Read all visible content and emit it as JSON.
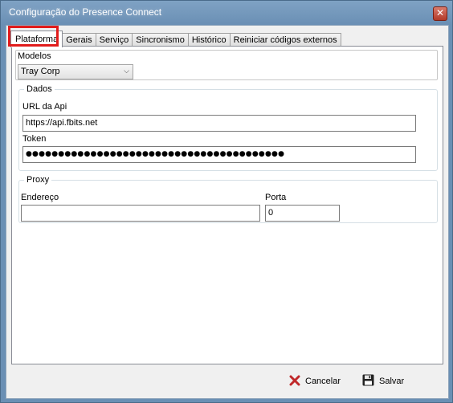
{
  "window": {
    "title": "Configuração do Presence Connect",
    "close_glyph": "✕"
  },
  "tabs": [
    {
      "label": "Plataforma",
      "active": true,
      "highlighted": true
    },
    {
      "label": "Gerais"
    },
    {
      "label": "Serviço"
    },
    {
      "label": "Sincronismo"
    },
    {
      "label": "Histórico"
    },
    {
      "label": "Reiniciar códigos externos"
    }
  ],
  "modelos": {
    "label": "Modelos",
    "selected": "Tray Corp",
    "icon": "chevron-down-icon"
  },
  "dados": {
    "legend": "Dados",
    "url_label": "URL da Api",
    "url_value": "https://api.fbits.net",
    "token_label": "Token",
    "token_value": "●●●●●●●●●●●●●●●●●●●●●●●●●●●●●●●●●●●●●●●●"
  },
  "proxy": {
    "legend": "Proxy",
    "endereco_label": "Endereço",
    "endereco_value": "",
    "porta_label": "Porta",
    "porta_value": "0"
  },
  "footer": {
    "cancel_label": "Cancelar",
    "cancel_icon": "x-icon",
    "save_label": "Salvar",
    "save_icon": "floppy-disk-icon"
  },
  "colors": {
    "highlight": "#e11b1b",
    "cancel_icon": "#c0282a"
  }
}
